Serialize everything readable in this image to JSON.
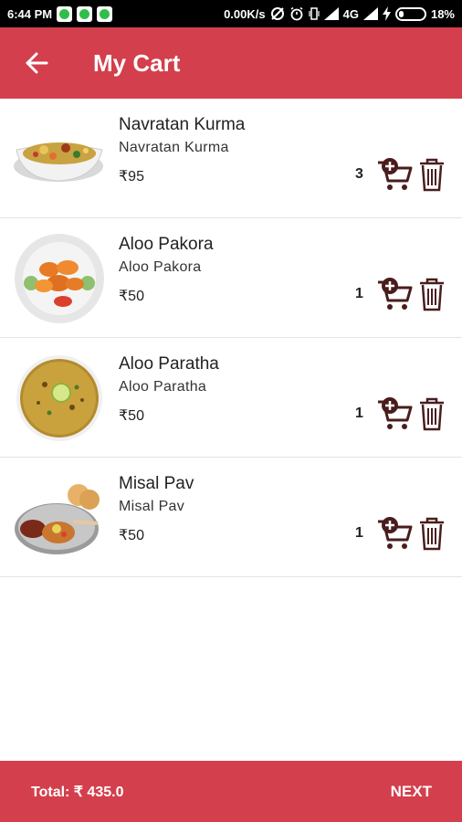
{
  "status_bar": {
    "time": "6:44 PM",
    "network_speed": "0.00K/s",
    "network_type": "4G",
    "battery": "18%"
  },
  "header": {
    "title": "My Cart",
    "back_icon": "arrow-left-icon"
  },
  "cart": {
    "items": [
      {
        "name": "Navratan Kurma",
        "subtitle": "Navratan Kurma",
        "price": "₹95",
        "quantity": "3"
      },
      {
        "name": "Aloo Pakora",
        "subtitle": "Aloo Pakora",
        "price": "₹50",
        "quantity": "1"
      },
      {
        "name": "Aloo Paratha",
        "subtitle": "Aloo Paratha",
        "price": "₹50",
        "quantity": "1"
      },
      {
        "name": "Misal Pav",
        "subtitle": "Misal Pav",
        "price": "₹50",
        "quantity": "1"
      }
    ]
  },
  "footer": {
    "total": "Total: ₹ 435.0",
    "next_label": "NEXT"
  },
  "colors": {
    "primary": "#d33f4c",
    "icon": "#4a1d1d"
  }
}
